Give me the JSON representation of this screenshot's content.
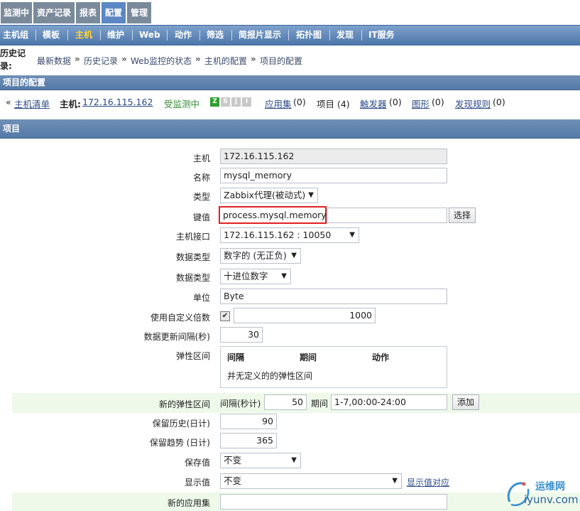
{
  "top_tabs": [
    {
      "label": "监测中",
      "active": false
    },
    {
      "label": "资产记录",
      "active": false
    },
    {
      "label": "报表",
      "active": false
    },
    {
      "label": "配置",
      "active": true
    },
    {
      "label": "管理",
      "active": false
    }
  ],
  "menu": [
    {
      "label": "主机组",
      "active": false
    },
    {
      "label": "模板",
      "active": false
    },
    {
      "label": "主机",
      "active": true
    },
    {
      "label": "维护",
      "active": false
    },
    {
      "label": "Web",
      "active": false
    },
    {
      "label": "动作",
      "active": false
    },
    {
      "label": "筛选",
      "active": false
    },
    {
      "label": "简报片显示",
      "active": false
    },
    {
      "label": "拓扑图",
      "active": false
    },
    {
      "label": "发现",
      "active": false
    },
    {
      "label": "IT服务",
      "active": false
    }
  ],
  "breadcrumb": {
    "title": "历史记录:",
    "items": [
      "最新数据",
      "历史记录",
      "Web监控的状态",
      "主机的配置",
      "项目的配置"
    ],
    "separator": "»"
  },
  "section_title": "项目的配置",
  "hostinfo": {
    "back_prefix": "«",
    "host_list": "主机清单",
    "host_label": "主机:",
    "host_value": "172.16.115.162",
    "monitored": "受监测中",
    "availability": [
      "Z",
      "S",
      "J",
      "I"
    ],
    "applications": "应用集",
    "applications_count": "(0)",
    "items": "项目 (4)",
    "triggers": "触发器",
    "triggers_count": "(0)",
    "graphs": "图形",
    "graphs_count": "(0)",
    "discovery": "发现规则",
    "discovery_count": "(0)"
  },
  "form_header": "项目",
  "form": {
    "host_label": "主机",
    "host_value": "172.16.115.162",
    "name_label": "名称",
    "name_value": "mysql_memory",
    "type_label": "类型",
    "type_value": "Zabbix代理(被动式)",
    "key_label": "键值",
    "key_value": "process.mysql.memory",
    "key_button": "选择",
    "interface_label": "主机接口",
    "interface_value": "172.16.115.162 : 10050",
    "datatype_label": "数据类型",
    "datatype_value": "数字的 (无正负)",
    "dataformat_label": "数据类型",
    "dataformat_value": "十进位数字",
    "units_label": "单位",
    "units_value": "Byte",
    "multiplier_label": "使用自定义倍数",
    "multiplier_checked": true,
    "multiplier_value": "1000",
    "interval_label": "数据更新间隔(秒)",
    "interval_value": "30",
    "flex_label": "弹性区间",
    "flex_col_interval": "间隔",
    "flex_col_period": "期间",
    "flex_col_action": "动作",
    "flex_empty": "并无定义的的弹性区间",
    "newflex_label": "新的弹性区间",
    "newflex_interval_label": "间隔(秒计)",
    "newflex_interval_value": "50",
    "newflex_period_label": "期间",
    "newflex_period_value": "1-7,00:00-24:00",
    "newflex_add": "添加",
    "history_label": "保留历史(日计)",
    "history_value": "90",
    "trends_label": "保留趋势 (日计)",
    "trends_value": "365",
    "store_label": "保存值",
    "store_value": "不变",
    "show_label": "显示值",
    "show_value": "不变",
    "show_mapping_link": "显示值对应",
    "newapp_label": "新的应用集",
    "newapp_value": ""
  },
  "colors": {
    "menu_blue": "#4c76ab",
    "active_menu_text": "#ffd23a",
    "highlight_border": "#e02020",
    "green_row": "#eef9ea"
  },
  "watermark": {
    "brand": "运维网",
    "domain": "iyunv.com"
  }
}
